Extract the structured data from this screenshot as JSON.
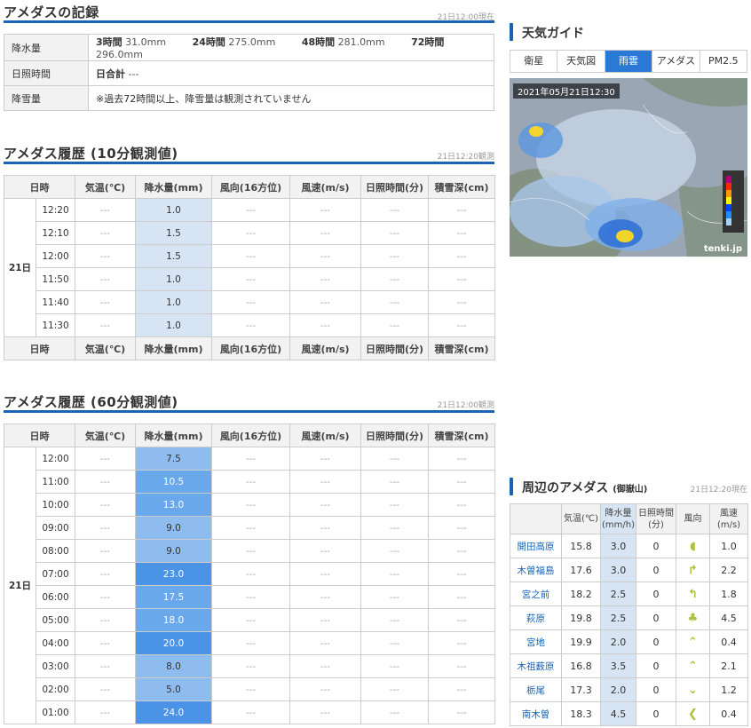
{
  "record": {
    "title": "アメダスの記録",
    "timestamp": "21日12:00現在",
    "rows": {
      "precip_label": "降水量",
      "h3_label": "3時間",
      "h3_val": "31.0mm",
      "h24_label": "24時間",
      "h24_val": "275.0mm",
      "h48_label": "48時間",
      "h48_val": "281.0mm",
      "h72_label": "72時間",
      "h72_val": "296.0mm",
      "sun_label": "日照時間",
      "sun_sum_label": "日合計",
      "sun_sum_val": "---",
      "snow_label": "降雪量",
      "snow_note": "※過去72時間以上、降雪量は観測されていません"
    }
  },
  "hist10": {
    "title": "アメダス履歴 (10分観測値)",
    "timestamp": "21日12:20観測",
    "day": "21日",
    "headers": [
      "日時",
      "気温(℃)",
      "降水量(mm)",
      "風向(16方位)",
      "風速(m/s)",
      "日照時間(分)",
      "積雪深(cm)"
    ],
    "rows": [
      {
        "time": "12:20",
        "temp": "---",
        "rain": "1.0",
        "dir": "---",
        "speed": "---",
        "sun": "---",
        "snow": "---"
      },
      {
        "time": "12:10",
        "temp": "---",
        "rain": "1.5",
        "dir": "---",
        "speed": "---",
        "sun": "---",
        "snow": "---"
      },
      {
        "time": "12:00",
        "temp": "---",
        "rain": "1.5",
        "dir": "---",
        "speed": "---",
        "sun": "---",
        "snow": "---"
      },
      {
        "time": "11:50",
        "temp": "---",
        "rain": "1.0",
        "dir": "---",
        "speed": "---",
        "sun": "---",
        "snow": "---"
      },
      {
        "time": "11:40",
        "temp": "---",
        "rain": "1.0",
        "dir": "---",
        "speed": "---",
        "sun": "---",
        "snow": "---"
      },
      {
        "time": "11:30",
        "temp": "---",
        "rain": "1.0",
        "dir": "---",
        "speed": "---",
        "sun": "---",
        "snow": "---"
      }
    ]
  },
  "hist60": {
    "title": "アメダス履歴 (60分観測値)",
    "timestamp": "21日12:00観測",
    "day": "21日",
    "headers": [
      "日時",
      "気温(℃)",
      "降水量(mm)",
      "風向(16方位)",
      "風速(m/s)",
      "日照時間(分)",
      "積雪深(cm)"
    ],
    "rows": [
      {
        "time": "12:00",
        "temp": "---",
        "rain": "7.5",
        "dir": "---",
        "speed": "---",
        "sun": "---",
        "snow": "---"
      },
      {
        "time": "11:00",
        "temp": "---",
        "rain": "10.5",
        "dir": "---",
        "speed": "---",
        "sun": "---",
        "snow": "---"
      },
      {
        "time": "10:00",
        "temp": "---",
        "rain": "13.0",
        "dir": "---",
        "speed": "---",
        "sun": "---",
        "snow": "---"
      },
      {
        "time": "09:00",
        "temp": "---",
        "rain": "9.0",
        "dir": "---",
        "speed": "---",
        "sun": "---",
        "snow": "---"
      },
      {
        "time": "08:00",
        "temp": "---",
        "rain": "9.0",
        "dir": "---",
        "speed": "---",
        "sun": "---",
        "snow": "---"
      },
      {
        "time": "07:00",
        "temp": "---",
        "rain": "23.0",
        "dir": "---",
        "speed": "---",
        "sun": "---",
        "snow": "---"
      },
      {
        "time": "06:00",
        "temp": "---",
        "rain": "17.5",
        "dir": "---",
        "speed": "---",
        "sun": "---",
        "snow": "---"
      },
      {
        "time": "05:00",
        "temp": "---",
        "rain": "18.0",
        "dir": "---",
        "speed": "---",
        "sun": "---",
        "snow": "---"
      },
      {
        "time": "04:00",
        "temp": "---",
        "rain": "20.0",
        "dir": "---",
        "speed": "---",
        "sun": "---",
        "snow": "---"
      },
      {
        "time": "03:00",
        "temp": "---",
        "rain": "8.0",
        "dir": "---",
        "speed": "---",
        "sun": "---",
        "snow": "---"
      },
      {
        "time": "02:00",
        "temp": "---",
        "rain": "5.0",
        "dir": "---",
        "speed": "---",
        "sun": "---",
        "snow": "---"
      },
      {
        "time": "01:00",
        "temp": "---",
        "rain": "24.0",
        "dir": "---",
        "speed": "---",
        "sun": "---",
        "snow": "---"
      }
    ]
  },
  "guide": {
    "title": "天気ガイド",
    "tabs": [
      "衛星",
      "天気図",
      "雨雲",
      "アメダス",
      "PM2.5"
    ],
    "active_tab": "雨雲",
    "radar_time": "2021年05月21日12:30",
    "brand": "tenki.jp"
  },
  "nearby": {
    "title": "周辺のアメダス",
    "subtitle": "(御嶽山)",
    "timestamp": "21日12:20現在",
    "headers": {
      "temp": "気温(℃)",
      "rain_1": "降水量",
      "rain_2": "(mm/h)",
      "sun_1": "日照時間",
      "sun_2": "(分)",
      "dir": "風向",
      "speed_1": "風速",
      "speed_2": "(m/s)"
    },
    "rows": [
      {
        "name": "開田高原",
        "temp": "15.8",
        "rain": "3.0",
        "sun": "0",
        "dir_icon": "wind-arrow-icon",
        "speed": "1.0"
      },
      {
        "name": "木曽福島",
        "temp": "17.6",
        "rain": "3.0",
        "sun": "0",
        "dir_icon": "wind-arrow-icon",
        "speed": "2.2"
      },
      {
        "name": "宮之前",
        "temp": "18.2",
        "rain": "2.5",
        "sun": "0",
        "dir_icon": "wind-arrow-icon",
        "speed": "1.8"
      },
      {
        "name": "萩原",
        "temp": "19.8",
        "rain": "2.5",
        "sun": "0",
        "dir_icon": "wind-arrow-icon",
        "speed": "4.5"
      },
      {
        "name": "宮地",
        "temp": "19.9",
        "rain": "2.0",
        "sun": "0",
        "dir_icon": "wind-arrow-icon",
        "speed": "0.4"
      },
      {
        "name": "木祖薮原",
        "temp": "16.8",
        "rain": "3.5",
        "sun": "0",
        "dir_icon": "wind-arrow-icon",
        "speed": "2.1"
      },
      {
        "name": "栃尾",
        "temp": "17.3",
        "rain": "2.0",
        "sun": "0",
        "dir_icon": "wind-arrow-icon",
        "speed": "1.2"
      },
      {
        "name": "南木曽",
        "temp": "18.3",
        "rain": "4.5",
        "sun": "0",
        "dir_icon": "wind-arrow-icon",
        "speed": "0.4"
      }
    ]
  },
  "colors": {
    "accent": "#1a64b5",
    "tab_active": "#2a7ad5",
    "rain_light": "#d6e4f3",
    "rain_mid": "#8fbcee",
    "rain_strong": "#6aa8ec",
    "rain_heavy": "#4a93e6"
  }
}
